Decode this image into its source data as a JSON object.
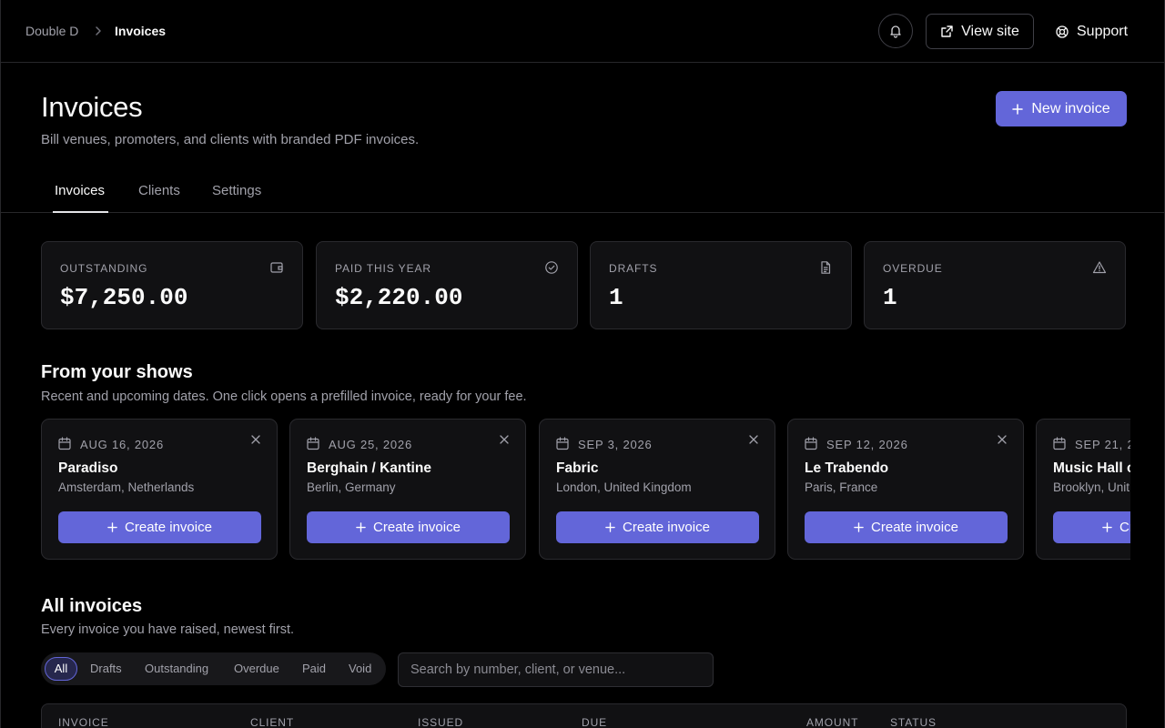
{
  "breadcrumb": {
    "home": "Double D",
    "current": "Invoices"
  },
  "topbar": {
    "view_site": "View site",
    "support": "Support"
  },
  "header": {
    "title": "Invoices",
    "subtitle": "Bill venues, promoters, and clients with branded PDF invoices.",
    "new_invoice": "New invoice"
  },
  "tabs": [
    {
      "label": "Invoices",
      "active": true
    },
    {
      "label": "Clients",
      "active": false
    },
    {
      "label": "Settings",
      "active": false
    }
  ],
  "stats": [
    {
      "label": "OUTSTANDING",
      "value": "$7,250.00",
      "icon": "wallet-icon"
    },
    {
      "label": "PAID THIS YEAR",
      "value": "$2,220.00",
      "icon": "check-circle-icon"
    },
    {
      "label": "DRAFTS",
      "value": "1",
      "icon": "document-icon"
    },
    {
      "label": "OVERDUE",
      "value": "1",
      "icon": "warning-icon"
    }
  ],
  "shows": {
    "title": "From your shows",
    "subtitle": "Recent and upcoming dates. One click opens a prefilled invoice, ready for your fee.",
    "button_label": "Create invoice",
    "items": [
      {
        "date": "AUG 16, 2026",
        "venue": "Paradiso",
        "place": "Amsterdam, Netherlands"
      },
      {
        "date": "AUG 25, 2026",
        "venue": "Berghain / Kantine",
        "place": "Berlin, Germany"
      },
      {
        "date": "SEP 3, 2026",
        "venue": "Fabric",
        "place": "London, United Kingdom"
      },
      {
        "date": "SEP 12, 2026",
        "venue": "Le Trabendo",
        "place": "Paris, France"
      },
      {
        "date": "SEP 21, 20",
        "venue": "Music Hall o",
        "place": "Brooklyn, Unit"
      }
    ]
  },
  "all_invoices": {
    "title": "All invoices",
    "subtitle": "Every invoice you have raised, newest first.",
    "filters": [
      "All",
      "Drafts",
      "Outstanding",
      "Overdue",
      "Paid",
      "Void"
    ],
    "search_placeholder": "Search by number, client, or venue...",
    "columns": [
      "INVOICE",
      "CLIENT",
      "ISSUED",
      "DUE",
      "AMOUNT",
      "STATUS"
    ]
  },
  "colors": {
    "accent": "#6366d9",
    "background": "#000000",
    "card": "#111113"
  }
}
